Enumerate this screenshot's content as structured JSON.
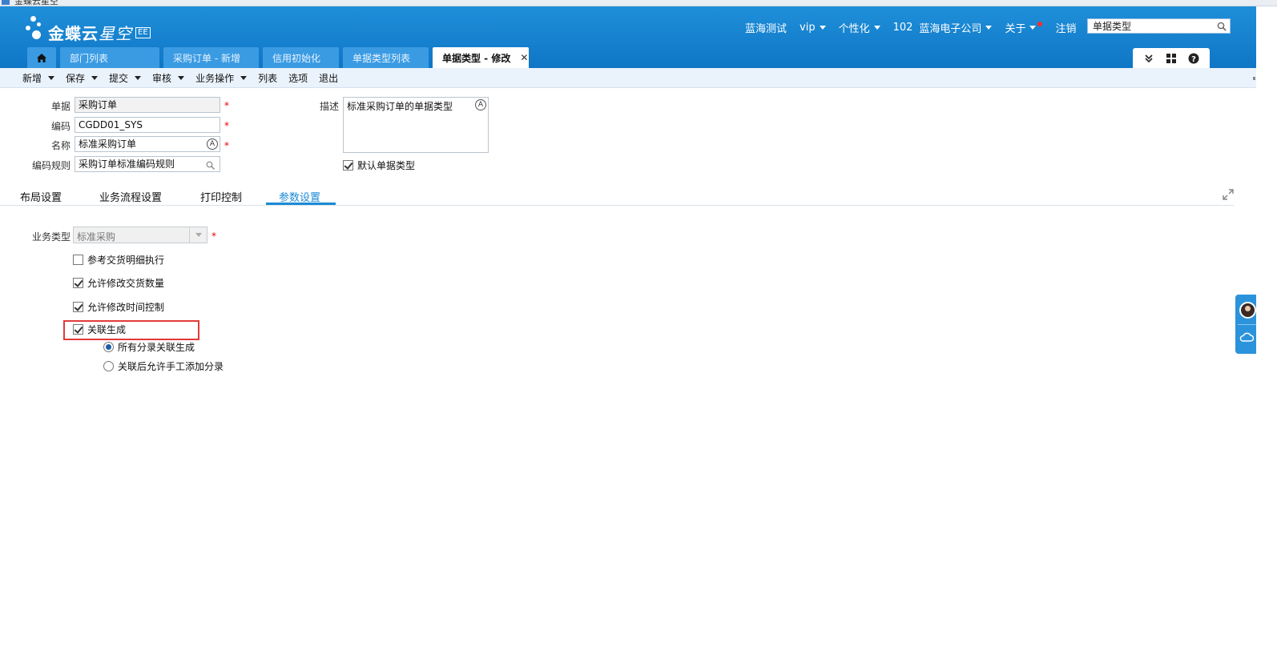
{
  "window": {
    "title": "金蝶云星空"
  },
  "brand": {
    "name": "金蝶云",
    "product": "星空",
    "edition": "EE"
  },
  "topnav": {
    "user": "蓝海测试",
    "vip": "vip",
    "personalize": "个性化",
    "org_code": "102",
    "org_name": "蓝海电子公司",
    "about": "关于",
    "logout": "注销",
    "search_value": "单据类型"
  },
  "tabs": [
    {
      "label": "部门列表"
    },
    {
      "label": "采购订单 - 新增"
    },
    {
      "label": "信用初始化"
    },
    {
      "label": "单据类型列表"
    },
    {
      "label": "单据类型 - 修改",
      "active": true
    }
  ],
  "toolbar": {
    "new": "新增",
    "save": "保存",
    "submit": "提交",
    "audit": "审核",
    "business_ops": "业务操作",
    "list": "列表",
    "options": "选项",
    "exit": "退出"
  },
  "form": {
    "bill_label": "单据",
    "bill_value": "采购订单",
    "code_label": "编码",
    "code_value": "CGDD01_SYS",
    "name_label": "名称",
    "name_value": "标准采购订单",
    "rule_label": "编码规则",
    "rule_value": "采购订单标准编码规则",
    "desc_label": "描述",
    "desc_value": "标准采购订单的单据类型",
    "default_label": "默认单据类型",
    "default_checked": true,
    "required_mark": "*",
    "lang_icon": "A"
  },
  "section_tabs": [
    {
      "label": "布局设置"
    },
    {
      "label": "业务流程设置"
    },
    {
      "label": "打印控制"
    },
    {
      "label": "参数设置",
      "active": true
    }
  ],
  "params": {
    "biz_type_label": "业务类型",
    "biz_type_value": "标准采购",
    "options": [
      {
        "label": "参考交货明细执行",
        "checked": false
      },
      {
        "label": "允许修改交货数量",
        "checked": true
      },
      {
        "label": "允许修改时间控制",
        "checked": true
      },
      {
        "label": "关联生成",
        "checked": true
      }
    ],
    "radios": [
      {
        "label": "所有分录关联生成",
        "selected": true
      },
      {
        "label": "关联后允许手工添加分录",
        "selected": false
      }
    ]
  },
  "colors": {
    "header_blue": "#1383d0",
    "tab_blue": "#3a9be3",
    "active_tab_text": "#1a8ad6",
    "highlight_red": "#e23a3a",
    "required_red": "#e00000"
  },
  "icons": [
    "home-icon",
    "search-icon",
    "chevrons-down-icon",
    "grid-icon",
    "help-icon",
    "close-icon",
    "expand-icon",
    "avatar",
    "cloud-icon"
  ]
}
